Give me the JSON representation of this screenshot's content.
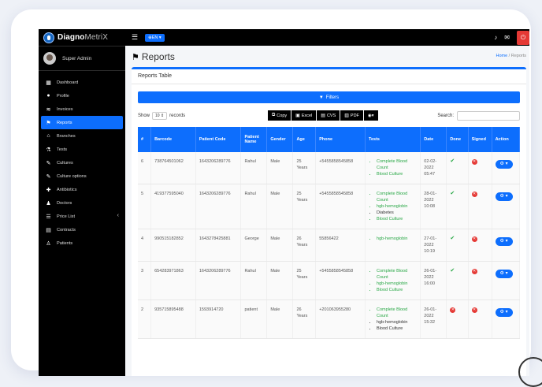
{
  "brand": {
    "bold": "Diagno",
    "light": "MetriX"
  },
  "user": {
    "name": "Super Admin"
  },
  "topbar": {
    "lang": "EN"
  },
  "sidebar": {
    "items": [
      {
        "label": "Dashboard",
        "icon": "dashboard-icon"
      },
      {
        "label": "Profile",
        "icon": "user-icon"
      },
      {
        "label": "Invoices",
        "icon": "invoices-icon"
      },
      {
        "label": "Reports",
        "icon": "flag-icon"
      },
      {
        "label": "Branches",
        "icon": "branches-icon"
      },
      {
        "label": "Tests",
        "icon": "flask-icon"
      },
      {
        "label": "Cultures",
        "icon": "pen-icon"
      },
      {
        "label": "Culture options",
        "icon": "pen-icon"
      },
      {
        "label": "Antibiotics",
        "icon": "antibiotics-icon"
      },
      {
        "label": "Doctors",
        "icon": "doctor-icon"
      },
      {
        "label": "Price List",
        "icon": "list-icon"
      },
      {
        "label": "Contracts",
        "icon": "contract-icon"
      },
      {
        "label": "Patients",
        "icon": "patients-icon"
      }
    ]
  },
  "page": {
    "title": "Reports",
    "crumb_home": "Home",
    "crumb_sep": "/",
    "crumb_current": "Reports"
  },
  "card": {
    "title": "Reports Table",
    "filters_label": "Filters",
    "show_label": "Show",
    "show_value": "10",
    "records_label": "records",
    "search_label": "Search:",
    "exports": [
      "Copy",
      "Excel",
      "CVS",
      "PDF"
    ]
  },
  "table": {
    "headers": [
      "#",
      "Barcode",
      "Patient Code",
      "Patient Name",
      "Gender",
      "Age",
      "Phone",
      "Tests",
      "Date",
      "Done",
      "Signed",
      "Action"
    ],
    "rows": [
      {
        "id": "6",
        "barcode": "738764501062",
        "code": "1643206289776",
        "name": "Rahul",
        "gender": "Male",
        "age": "25 Years",
        "phone": "+5455858545858",
        "tests": [
          {
            "t": "Complete Blood Count",
            "ok": true
          },
          {
            "t": "Blood Culture",
            "ok": true
          }
        ],
        "date": "02-02-2022 05:47",
        "done": true,
        "signed": false
      },
      {
        "id": "5",
        "barcode": "419377595040",
        "code": "1643206289776",
        "name": "Rahul",
        "gender": "Male",
        "age": "25 Years",
        "phone": "+5455858545858",
        "tests": [
          {
            "t": "Complete Blood Count",
            "ok": true
          },
          {
            "t": "hgb-hemoglobin",
            "ok": true
          },
          {
            "t": "Diabetes",
            "ok": false
          },
          {
            "t": "Blood Culture",
            "ok": true
          }
        ],
        "date": "28-01-2022 10:08",
        "done": true,
        "signed": false
      },
      {
        "id": "4",
        "barcode": "990515182852",
        "code": "1643278425881",
        "name": "George",
        "gender": "Male",
        "age": "26 Years",
        "phone": "55856422",
        "tests": [
          {
            "t": "hgb-hemoglobin",
            "ok": true
          }
        ],
        "date": "27-01-2022 10:19",
        "done": true,
        "signed": false
      },
      {
        "id": "3",
        "barcode": "654283971863",
        "code": "1643206289776",
        "name": "Rahul",
        "gender": "Male",
        "age": "25 Years",
        "phone": "+5455858545858",
        "tests": [
          {
            "t": "Complete Blood Count",
            "ok": true
          },
          {
            "t": "hgb-hemoglobin",
            "ok": true
          },
          {
            "t": "Blood Culture",
            "ok": true
          }
        ],
        "date": "26-01-2022 16:00",
        "done": true,
        "signed": false
      },
      {
        "id": "2",
        "barcode": "935715895488",
        "code": "1593914720",
        "name": "patient",
        "gender": "Male",
        "age": "26 Years",
        "phone": "+201063955280",
        "tests": [
          {
            "t": "Complete Blood Count",
            "ok": true
          },
          {
            "t": "hgb-hemoglobin",
            "ok": false
          },
          {
            "t": "Blood Culture",
            "ok": false
          }
        ],
        "date": "26-01-2022 15:32",
        "done": false,
        "signed": false
      }
    ]
  }
}
